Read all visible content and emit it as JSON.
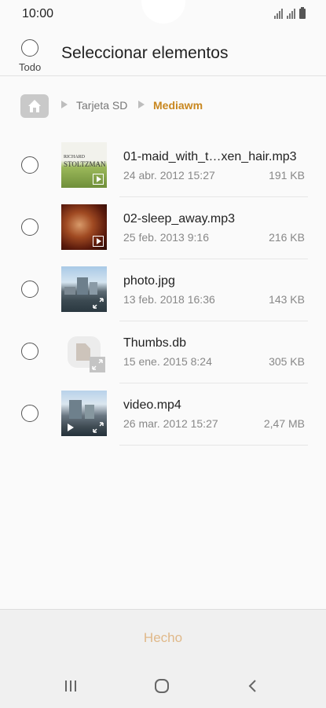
{
  "status_bar": {
    "time": "10:00",
    "icons": [
      "signal-icon",
      "signal-icon",
      "battery-icon"
    ]
  },
  "header": {
    "select_all_label": "Todo",
    "title": "Seleccionar elementos"
  },
  "breadcrumb": {
    "home_icon": "home-icon",
    "items": [
      "Tarjeta SD",
      "Mediawm"
    ],
    "current_color": "#c8871f"
  },
  "files": [
    {
      "name": "01-maid_with_t…xen_hair.mp3",
      "date": "24 abr. 2012 15:27",
      "size": "191 KB",
      "thumb": "album-cover",
      "thumb_text_1": "RICHARD",
      "thumb_text_2": "STOLTZMAN",
      "badge": "play-icon"
    },
    {
      "name": "02-sleep_away.mp3",
      "date": "25 feb. 2013 9:16",
      "size": "216 KB",
      "thumb": "album-cover",
      "badge": "play-icon"
    },
    {
      "name": "photo.jpg",
      "date": "13 feb. 2018 16:36",
      "size": "143 KB",
      "thumb": "photo",
      "badge": "expand-icon"
    },
    {
      "name": "Thumbs.db",
      "date": "15 ene. 2015 8:24",
      "size": "305 KB",
      "thumb": "document-icon",
      "badge": "expand-icon"
    },
    {
      "name": "video.mp4",
      "date": "26 mar. 2012 15:27",
      "size": "2,47 MB",
      "thumb": "video",
      "badge": "play-icon"
    }
  ],
  "footer": {
    "done_label": "Hecho",
    "done_color": "#e0b98a"
  },
  "nav_bar": {
    "buttons": [
      "recents-icon",
      "home-nav-icon",
      "back-icon"
    ]
  }
}
